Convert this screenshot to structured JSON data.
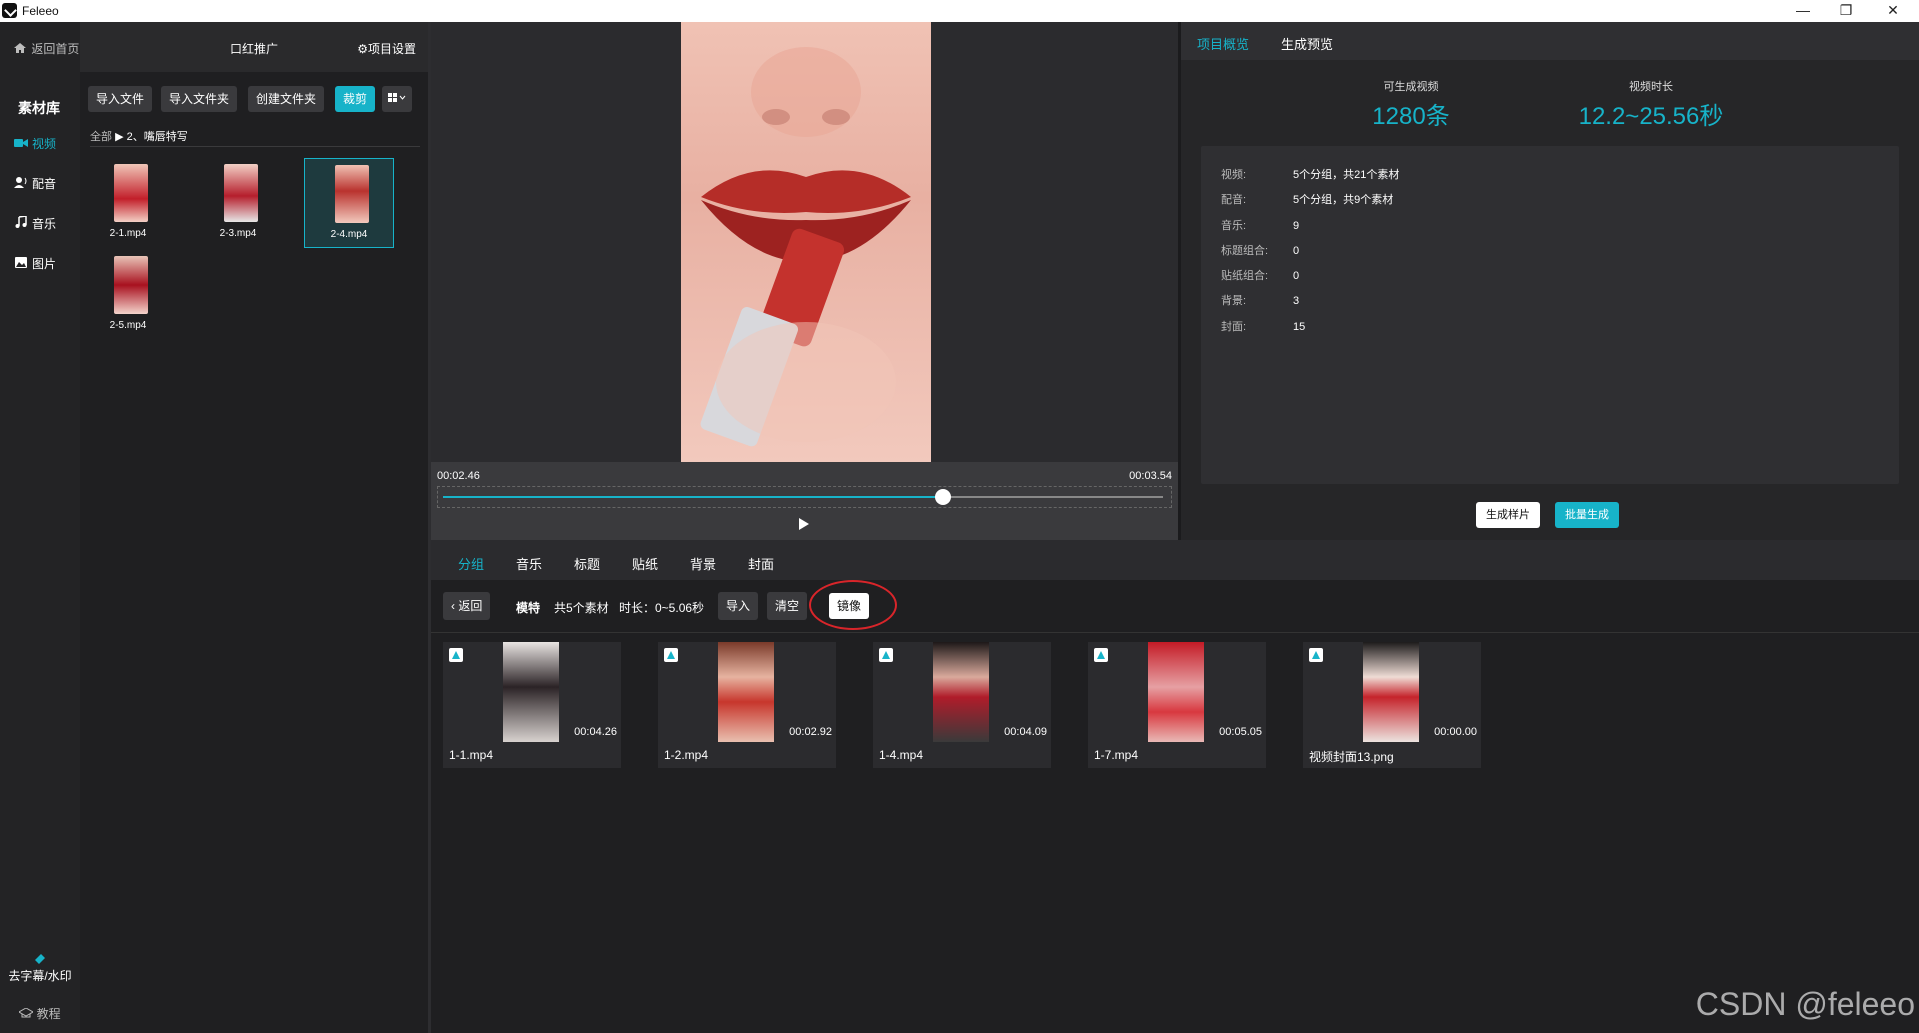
{
  "window": {
    "title": "Feleeo",
    "controls": [
      "—",
      "❐",
      "✕"
    ]
  },
  "left_nav": {
    "home_label": "返回首页",
    "section_title": "素材库",
    "items": [
      {
        "icon": "video-camera-icon",
        "label": "视频",
        "active": true
      },
      {
        "icon": "dubbing-icon",
        "label": "配音",
        "active": false
      },
      {
        "icon": "music-note-icon",
        "label": "音乐",
        "active": false
      },
      {
        "icon": "image-icon",
        "label": "图片",
        "active": false
      }
    ],
    "tools": [
      {
        "icon": "eraser-icon",
        "label": "去字幕/水印"
      },
      {
        "icon": "graduation-cap-icon",
        "label": "教程"
      }
    ]
  },
  "material_panel": {
    "project_name": "口红推广",
    "settings_label": "项目设置",
    "toolbar": {
      "import_file": "导入文件",
      "import_folder": "导入文件夹",
      "create_folder": "创建文件夹",
      "crop": "裁剪",
      "view_icon": "grid-view-icon"
    },
    "breadcrumb": {
      "root": "全部",
      "separator": "▶",
      "current": "2、嘴唇特写"
    },
    "files": [
      {
        "name": "2-1.mp4",
        "selected": false
      },
      {
        "name": "2-3.mp4",
        "selected": false
      },
      {
        "name": "2-4.mp4",
        "selected": true
      },
      {
        "name": "2-5.mp4",
        "selected": false
      }
    ]
  },
  "player": {
    "current_time": "00:02.46",
    "total_time": "00:03.54",
    "progress": 0.695
  },
  "overview": {
    "tabs": [
      {
        "label": "项目概览",
        "active": true
      },
      {
        "label": "生成预览",
        "active": false
      }
    ],
    "stats": [
      {
        "label": "可生成视频",
        "value": "1280条"
      },
      {
        "label": "视频时长",
        "value": "12.2~25.56秒"
      }
    ],
    "details": [
      {
        "key": "视频:",
        "value": "5个分组，共21个素材"
      },
      {
        "key": "配音:",
        "value": "5个分组，共9个素材"
      },
      {
        "key": "音乐:",
        "value": "9"
      },
      {
        "key": "标题组合:",
        "value": "0"
      },
      {
        "key": "贴纸组合:",
        "value": "0"
      },
      {
        "key": "背景:",
        "value": "3"
      },
      {
        "key": "封面:",
        "value": "15"
      }
    ],
    "buttons": {
      "sample": "生成样片",
      "batch": "批量生成"
    }
  },
  "bottom": {
    "tabs": [
      {
        "label": "分组",
        "active": true
      },
      {
        "label": "音乐",
        "active": false
      },
      {
        "label": "标题",
        "active": false
      },
      {
        "label": "贴纸",
        "active": false
      },
      {
        "label": "背景",
        "active": false
      },
      {
        "label": "封面",
        "active": false
      }
    ],
    "group_bar": {
      "back_label": "返回",
      "group_name": "模特",
      "count_text": "共5个素材",
      "duration_text": "时长：0~5.06秒",
      "import_label": "导入",
      "clear_label": "清空",
      "mirror_label": "镜像"
    },
    "clips": [
      {
        "name": "1-1.mp4",
        "duration": "00:04.26"
      },
      {
        "name": "1-2.mp4",
        "duration": "00:02.92"
      },
      {
        "name": "1-4.mp4",
        "duration": "00:04.09"
      },
      {
        "name": "1-7.mp4",
        "duration": "00:05.05"
      },
      {
        "name": "视频封面13.png",
        "duration": "00:00.00"
      }
    ]
  },
  "watermark": "CSDN @feleeo",
  "colors": {
    "accent": "#17b3c9",
    "highlight_ring": "#d9252a"
  }
}
